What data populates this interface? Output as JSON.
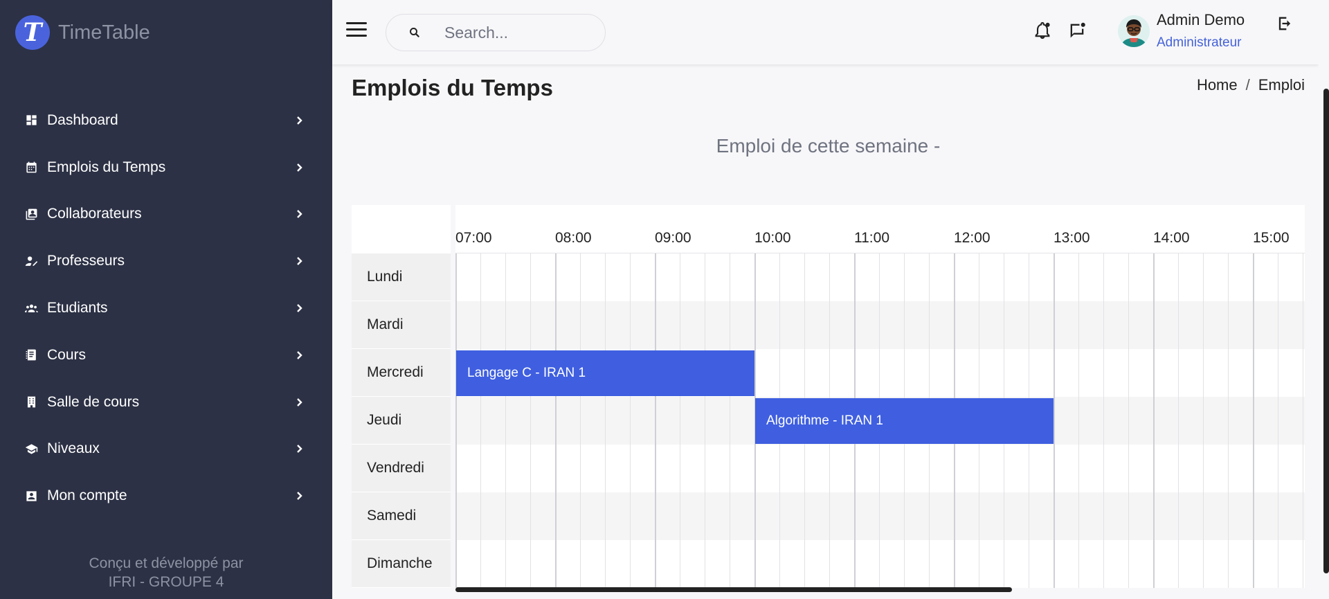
{
  "sidebar": {
    "brand_letter": "T",
    "brand_name": "TimeTable",
    "items": [
      {
        "label": "Dashboard",
        "icon": "dashboard-icon"
      },
      {
        "label": "Emplois du Temps",
        "icon": "calendar-icon"
      },
      {
        "label": "Collaborateurs",
        "icon": "collaborators-icon"
      },
      {
        "label": "Professeurs",
        "icon": "professor-icon"
      },
      {
        "label": "Etudiants",
        "icon": "students-icon"
      },
      {
        "label": "Cours",
        "icon": "book-icon"
      },
      {
        "label": "Salle de cours",
        "icon": "building-icon"
      },
      {
        "label": "Niveaux",
        "icon": "graduation-cap-icon"
      },
      {
        "label": "Mon compte",
        "icon": "account-icon"
      }
    ],
    "footer_line1": "Conçu et développé par",
    "footer_line2": "IFRI - GROUPE 4"
  },
  "topbar": {
    "search_placeholder": "Search...",
    "user_name": "Admin Demo",
    "user_role": "Administrateur"
  },
  "page": {
    "title": "Emplois du Temps",
    "breadcrumb": [
      "Home",
      "Emploi"
    ],
    "week_title": "Emploi de cette semaine -"
  },
  "timetable": {
    "hours": [
      "07:00",
      "08:00",
      "09:00",
      "10:00",
      "11:00",
      "12:00",
      "13:00",
      "14:00",
      "15:00"
    ],
    "days": [
      "Lundi",
      "Mardi",
      "Mercredi",
      "Jeudi",
      "Vendredi",
      "Samedi",
      "Dimanche"
    ],
    "events": [
      {
        "label": "Langage C - IRAN 1",
        "day": "Mercredi",
        "start": "07:00",
        "end": "10:00"
      },
      {
        "label": "Algorithme - IRAN 1",
        "day": "Jeudi",
        "start": "10:00",
        "end": "13:00"
      }
    ]
  },
  "colors": {
    "sidebar_bg": "#2c3145",
    "accent": "#3f5fe0",
    "muted_text": "#8e93a3"
  }
}
